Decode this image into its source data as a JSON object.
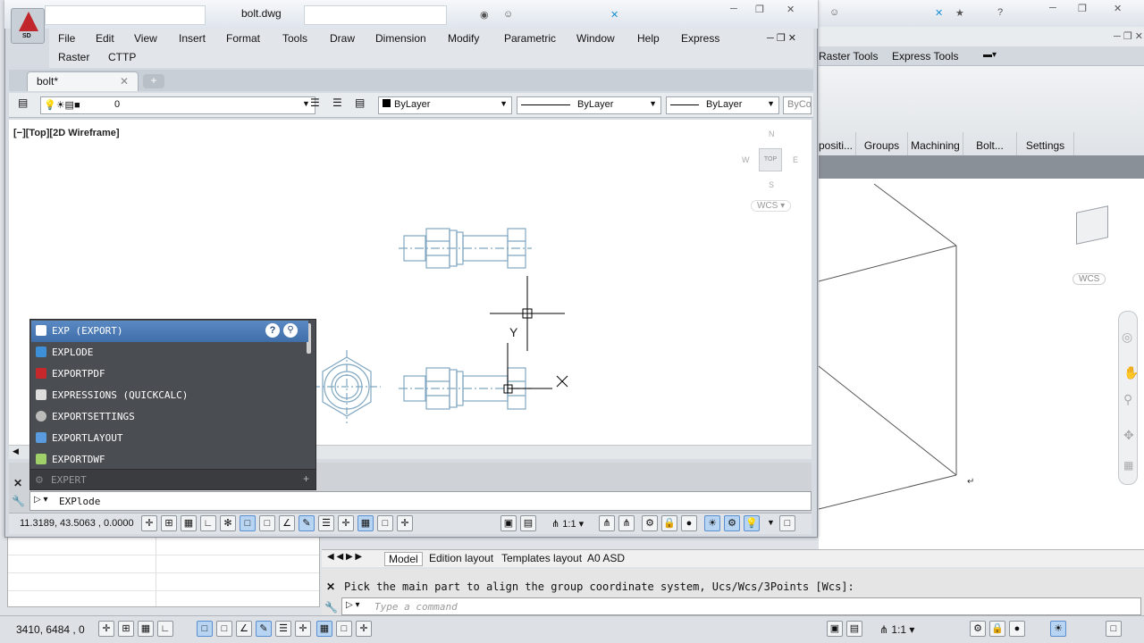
{
  "bg_window": {
    "ribbon_tabs": [
      "Raster Tools",
      "Express Tools"
    ],
    "panels": [
      "positi...",
      "Groups",
      "Machining",
      "Bolt...",
      "Settings"
    ],
    "viewcube_label": "WCS",
    "layout_tabs": [
      "Model",
      "Edition layout",
      "Templates layout",
      "A0 ASD"
    ],
    "command_history": "Pick the main part to align the group coordinate system, Ucs/Wcs/3Points [Wcs]:",
    "command_placeholder": "Type a command",
    "coords": "3410, 6484 , 0",
    "scale": "1:1"
  },
  "fg_window": {
    "title": "bolt.dwg",
    "logo_text": "SD",
    "menu_row1": [
      "File",
      "Edit",
      "View",
      "Insert",
      "Format",
      "Tools",
      "Draw",
      "Dimension",
      "Modify",
      "Parametric",
      "Window",
      "Help",
      "Express"
    ],
    "menu_row2": [
      "Raster",
      "CTTP"
    ],
    "doc_tab": "bolt*",
    "layer_value": "0",
    "color_value": "ByLayer",
    "linetype_value": "ByLayer",
    "lineweight_value": "ByLayer",
    "plotstyle_value": "ByCo",
    "viewport_label": "[−][Top][2D Wireframe]",
    "viewcube": {
      "top": "TOP",
      "north": "N",
      "south": "S",
      "east": "E",
      "west": "W",
      "wcs": "WCS"
    },
    "ucs_y_label": "Y",
    "command_input": "EXPlode",
    "coords": "11.3189, 43.5063 , 0.0000",
    "scale": "1:1"
  },
  "autocomplete": {
    "items": [
      {
        "label": "EXP (EXPORT)",
        "icon": "export-icon",
        "selected": true
      },
      {
        "label": "EXPLODE",
        "icon": "explode-icon",
        "selected": false
      },
      {
        "label": "EXPORTPDF",
        "icon": "pdf-icon",
        "selected": false
      },
      {
        "label": "EXPRESSIONS (QUICKCALC)",
        "icon": "calculator-icon",
        "selected": false
      },
      {
        "label": "EXPORTSETTINGS",
        "icon": "settings-icon",
        "selected": false
      },
      {
        "label": "EXPORTLAYOUT",
        "icon": "layout-icon",
        "selected": false
      },
      {
        "label": "EXPORTDWF",
        "icon": "dwf-icon",
        "selected": false
      }
    ],
    "footer_item": "EXPERT"
  },
  "colors": {
    "selection": "#4a79b6",
    "autocomplete_bg": "#4a4d51",
    "drawing_lines": "#7fa6c0"
  }
}
